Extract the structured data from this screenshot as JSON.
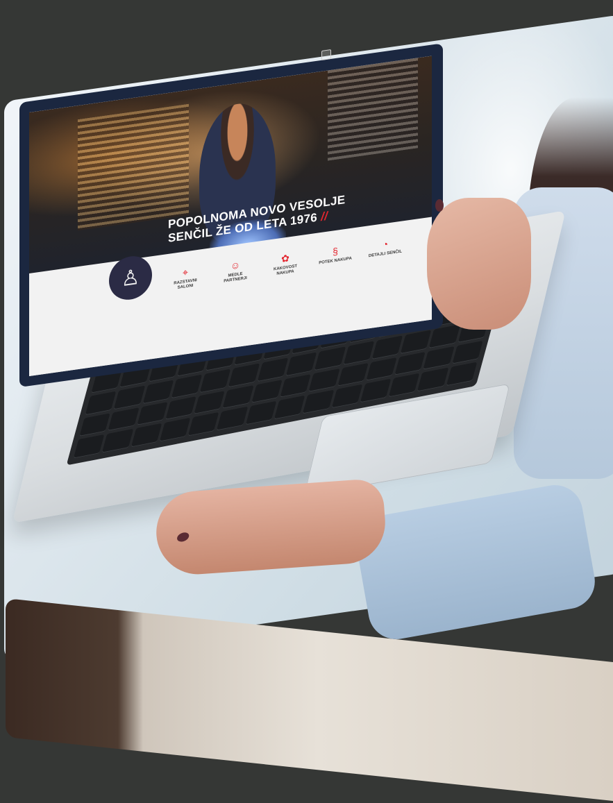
{
  "screen": {
    "headline_line1": "POPOLNOMA NOVO VESOLJE",
    "headline_line2": "SENČIL ŽE OD LETA 1976",
    "headline_mark": "//",
    "nav": [
      {
        "icon": "location-pin-icon",
        "glyph": "⌖",
        "label": "RAZSTAVNI SALONI"
      },
      {
        "icon": "smiley-icon",
        "glyph": "☺",
        "label": "MEDLE PARTNERJI"
      },
      {
        "icon": "cluster-icon",
        "glyph": "✿",
        "label": "KAKOVOST NAKUPA"
      },
      {
        "icon": "flow-icon",
        "glyph": "§",
        "label": "POTEK NAKUPA"
      },
      {
        "icon": "pie-icon",
        "glyph": "◔",
        "label": "DETAJLI SENČIL"
      }
    ]
  },
  "colors": {
    "background": "#353735",
    "accent": "#e3262f",
    "bezel": "#1b2740"
  }
}
